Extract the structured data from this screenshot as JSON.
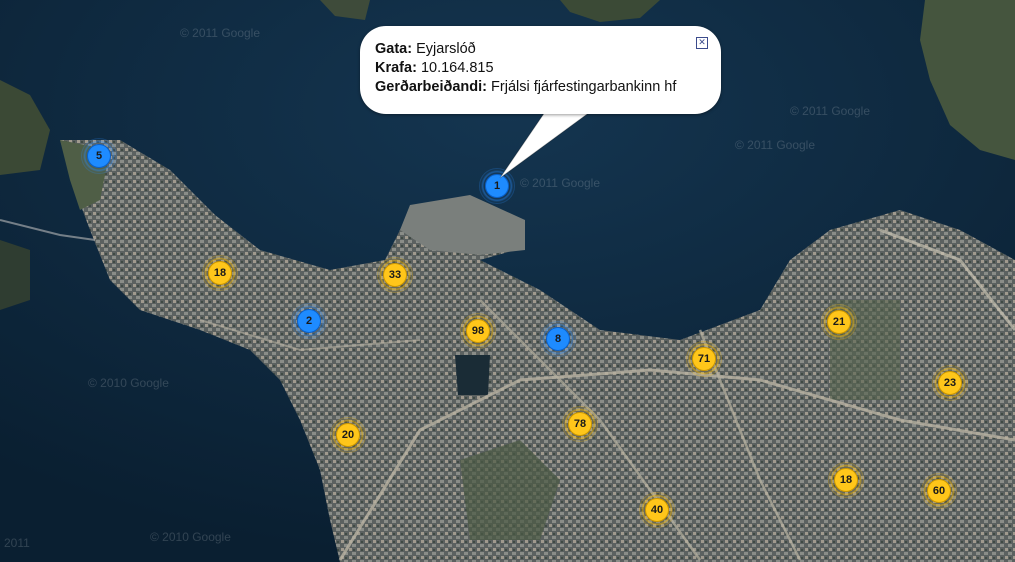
{
  "info_window": {
    "street_label": "Gata:",
    "street_value": "Eyjarslóð",
    "claim_label": "Krafa:",
    "claim_value": "10.164.815",
    "requester_label": "Gerðarbeiðandi:",
    "requester_value": "Frjálsi fjárfestingarbankinn hf",
    "close_icon": "close-icon"
  },
  "watermarks": [
    "© 2011 Google",
    "© 2011 Google",
    "© 2011 Google",
    "© 2010 Google",
    "© 2010 Google",
    "© 2011 Google",
    "2011"
  ],
  "clusters": [
    {
      "count": "5",
      "color": "blue"
    },
    {
      "count": "1",
      "color": "blue"
    },
    {
      "count": "18",
      "color": "yellow"
    },
    {
      "count": "33",
      "color": "yellow"
    },
    {
      "count": "2",
      "color": "blue"
    },
    {
      "count": "98",
      "color": "yellow"
    },
    {
      "count": "8",
      "color": "blue"
    },
    {
      "count": "71",
      "color": "yellow"
    },
    {
      "count": "21",
      "color": "yellow"
    },
    {
      "count": "23",
      "color": "yellow"
    },
    {
      "count": "20",
      "color": "yellow"
    },
    {
      "count": "78",
      "color": "yellow"
    },
    {
      "count": "18",
      "color": "yellow"
    },
    {
      "count": "60",
      "color": "yellow"
    },
    {
      "count": "40",
      "color": "yellow"
    }
  ],
  "colors": {
    "blue_cluster": "#1e8bff",
    "yellow_cluster": "#ffc61a",
    "sea": "#0b2236"
  }
}
